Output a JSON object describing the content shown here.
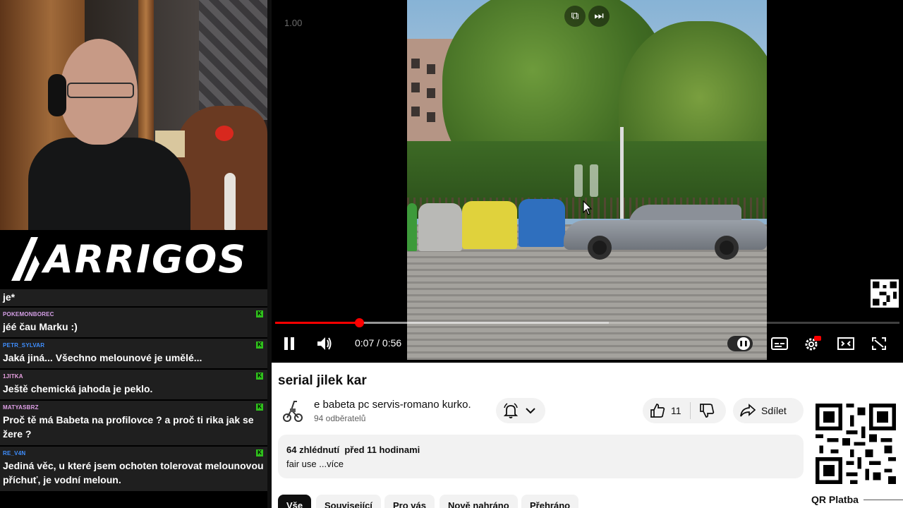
{
  "logo": {
    "text": "ARRIGOS"
  },
  "chat": [
    {
      "user": "",
      "text": "je*",
      "color": "#ffffff"
    },
    {
      "user": "POKEMONBOREC",
      "text": "jéé čau Marku :)",
      "color": "#d6a0e8"
    },
    {
      "user": "PETR_SYLVAR",
      "text": "Jaká jiná... Všechno melounové je umělé...",
      "color": "#3f8fff"
    },
    {
      "user": "1JITKA",
      "text": "Ještě chemická jahoda je peklo.",
      "color": "#e8a0e0"
    },
    {
      "user": "MATYASBRZ",
      "text": "Proč tě má Babeta na profilovce ? a proč ti rika jak se žere ?",
      "color": "#e0a0e8"
    },
    {
      "user": "RE_V4N",
      "text": "Jediná věc, u které jsem ochoten tolerovat melounovou příchuť, je vodní meloun.",
      "color": "#3f8fff"
    }
  ],
  "player": {
    "speed": "1.00",
    "time_current": "0:07",
    "time_separator": " / ",
    "time_total": "0:56",
    "progress": 0.135,
    "buffered": 0.535,
    "progress_color": "#ff0000"
  },
  "video": {
    "title": "serial jilek kar",
    "channel": "e babeta pc servis-romano kurko.",
    "subscribers": "94 odběratelů",
    "likes": "11",
    "share_label": "Sdílet",
    "stats": "64 zhlédnutí  před 11 hodinami",
    "description": "fair use",
    "more_label": "...více"
  },
  "chips": [
    "Vše",
    "Související",
    "Pro vás",
    "Nově nahráno",
    "Přehráno"
  ],
  "qr": {
    "label": "QR Platba"
  },
  "icons": {
    "pause": "pause-icon",
    "volume": "volume-icon",
    "subtitles": "subtitles-icon",
    "settings": "settings-icon",
    "theater": "theater-mode-icon",
    "fullscreen": "fullscreen-icon",
    "bell": "bell-icon",
    "like": "thumbs-up-icon",
    "dislike": "thumbs-down-icon",
    "share": "share-icon"
  }
}
